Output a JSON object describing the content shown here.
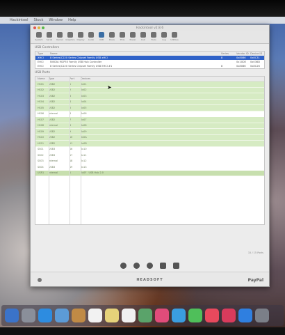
{
  "menubar": {
    "items": [
      "",
      "Hackintool",
      "Stock",
      "Window",
      "Help"
    ]
  },
  "window": {
    "title": "Hackintool v2.8.6"
  },
  "toolbar": {
    "items": [
      "System",
      "Serial",
      "Kernel",
      "Graphics",
      "Display",
      "Audio",
      "USB",
      "Disks",
      "PCIe",
      "Power",
      "Calc",
      "Tools",
      "Log",
      "Utilities"
    ]
  },
  "controllers": {
    "section_title": "USB Controllers",
    "columns": [
      "Type",
      "Name",
      "Series",
      "Vendor ID",
      "Device ID"
    ],
    "rows": [
      {
        "type": "XHCI",
        "name": "8 Series/C220 Series Chipset Family USB xHCI",
        "series": "8",
        "vendor": "0x8086",
        "device": "0x8C31",
        "selected": true
      },
      {
        "type": "EHCI",
        "name": "NVIDIA MCP55 Family USB Hub Controller",
        "series": "",
        "vendor": "0x10DE",
        "device": "0x036D",
        "selected": false
      },
      {
        "type": "EHCI",
        "name": "8 Series/C220 Series Chipset Family USB EHCI #1",
        "series": "8",
        "vendor": "0x8086",
        "device": "0x8C26",
        "selected": false
      }
    ]
  },
  "ports": {
    "section_title": "USB Ports",
    "columns": [
      "Name",
      "Type",
      "Port",
      "Devices"
    ],
    "rows": [
      {
        "name": "HS01",
        "type": "USB2",
        "port": "1",
        "comment": "0x01",
        "device": "",
        "style": "green"
      },
      {
        "name": "HS02",
        "type": "USB2",
        "port": "2",
        "comment": "0x02",
        "device": "",
        "style": "green"
      },
      {
        "name": "HS03",
        "type": "USB2",
        "port": "3",
        "comment": "0x03",
        "device": "",
        "style": "green"
      },
      {
        "name": "HS04",
        "type": "USB2",
        "port": "4",
        "comment": "0x04",
        "device": "",
        "style": "green"
      },
      {
        "name": "HS05",
        "type": "USB2",
        "port": "5",
        "comment": "0x05",
        "device": "",
        "style": "green"
      },
      {
        "name": "HS06",
        "type": "Internal",
        "port": "6",
        "comment": "0x06",
        "device": "",
        "style": "white"
      },
      {
        "name": "HS07",
        "type": "USB2",
        "port": "7",
        "comment": "0x07",
        "device": "",
        "style": "green"
      },
      {
        "name": "HS08",
        "type": "Internal",
        "port": "8",
        "comment": "0x08",
        "device": "",
        "style": "green"
      },
      {
        "name": "HS09",
        "type": "USB2",
        "port": "9",
        "comment": "0x09",
        "device": "",
        "style": "green"
      },
      {
        "name": "HS10",
        "type": "USB2",
        "port": "10",
        "comment": "0x0A",
        "device": "",
        "style": "green"
      },
      {
        "name": "HS11",
        "type": "USB2",
        "port": "11",
        "comment": "0x0B",
        "device": "",
        "style": "green"
      },
      {
        "name": "SS01",
        "type": "USB3",
        "port": "16",
        "comment": "0x10",
        "device": "",
        "style": "white"
      },
      {
        "name": "SS02",
        "type": "USB3",
        "port": "17",
        "comment": "0x11",
        "device": "",
        "style": "white"
      },
      {
        "name": "SS03",
        "type": "Internal",
        "port": "18",
        "comment": "0x12",
        "device": "",
        "style": "white"
      },
      {
        "name": "SS04",
        "type": "USB3",
        "port": "19",
        "comment": "0x13",
        "device": "",
        "style": "white"
      },
      {
        "name": "USR1",
        "type": "Internal",
        "port": "1",
        "comment": "0x0F",
        "device": "USB Hub 2.0",
        "style": "dark"
      }
    ]
  },
  "footer": {
    "brand": "HEADSOFT",
    "paypal": "PayPal",
    "counter": "15 / 15 Ports"
  },
  "colors": {
    "selection": "#2f62c8",
    "port_green": "#d6ebc3",
    "accent": "#3a6ea5"
  }
}
